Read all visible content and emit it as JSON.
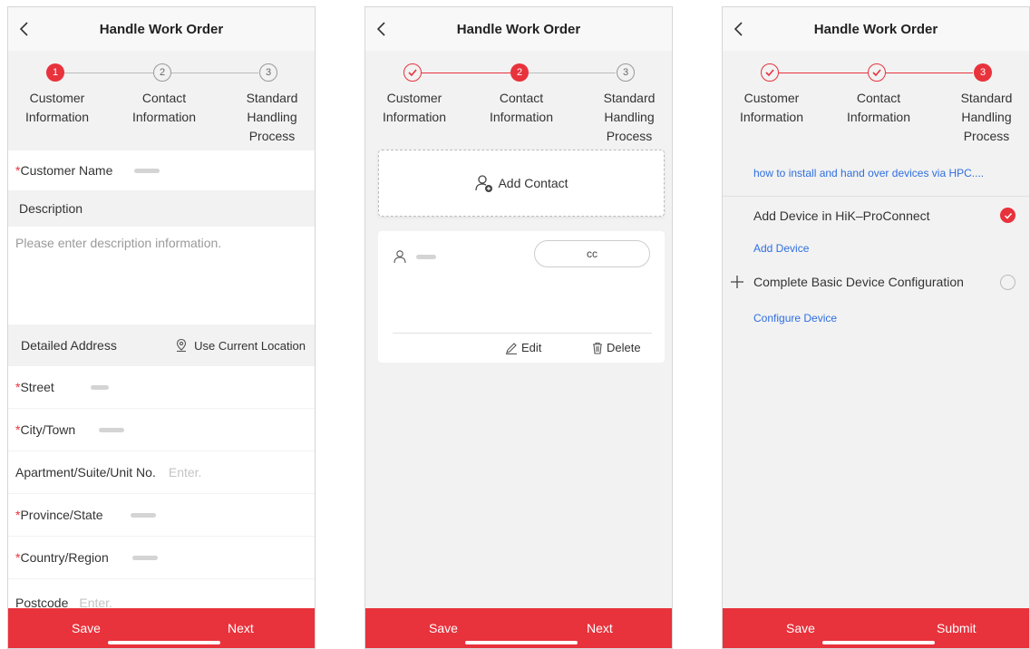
{
  "colors": {
    "accent": "#e8323c",
    "link": "#2f6fe0"
  },
  "header": {
    "title": "Handle Work Order"
  },
  "steps": {
    "customer": "Customer Information",
    "contact": "Contact Information",
    "process": "Standard Handling Process",
    "num1": "1",
    "num2": "2",
    "num3": "3"
  },
  "screen1": {
    "customer_name_label": "Customer Name",
    "description_label": "Description",
    "description_placeholder": "Please enter description information.",
    "detailed_address_label": "Detailed Address",
    "use_location_label": "Use Current Location",
    "street_label": "Street",
    "city_label": "City/Town",
    "apartment_label": "Apartment/Suite/Unit No.",
    "apartment_placeholder": "Enter.",
    "province_label": "Province/State",
    "country_label": "Country/Region",
    "postcode_label": "Postcode",
    "postcode_placeholder": "Enter.",
    "save": "Save",
    "next": "Next"
  },
  "screen2": {
    "add_contact": "Add Contact",
    "contact_tag": "cc",
    "edit": "Edit",
    "delete": "Delete",
    "save": "Save",
    "next": "Next"
  },
  "screen3": {
    "guide_link": "how to install and hand over devices via HPC....",
    "task1": "Add Device in HiK–ProConnect",
    "task1_link": "Add Device",
    "task2": "Complete Basic Device Configuration",
    "task2_link": "Configure Device",
    "save": "Save",
    "submit": "Submit"
  }
}
